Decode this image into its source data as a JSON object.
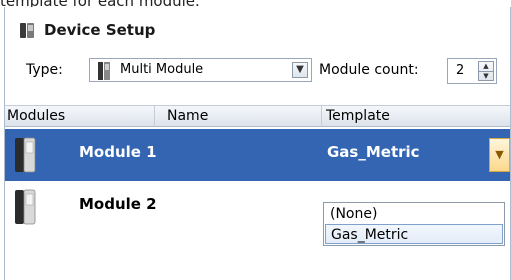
{
  "intro_text": "template for each module.",
  "title": "Device Setup",
  "type_row": {
    "type_label": "Type:",
    "type_value": "Multi Module",
    "count_label": "Module count:",
    "count_value": "2"
  },
  "columns": [
    "Modules",
    "Name",
    "Template"
  ],
  "rows": [
    {
      "name": "Module 1",
      "template": "Gas_Metric"
    },
    {
      "name": "Module 2",
      "template": ""
    }
  ],
  "template_options": [
    "(None)",
    "Gas_Metric"
  ],
  "colors": {
    "selection": "#3465b3",
    "border": "#aebcd0"
  }
}
